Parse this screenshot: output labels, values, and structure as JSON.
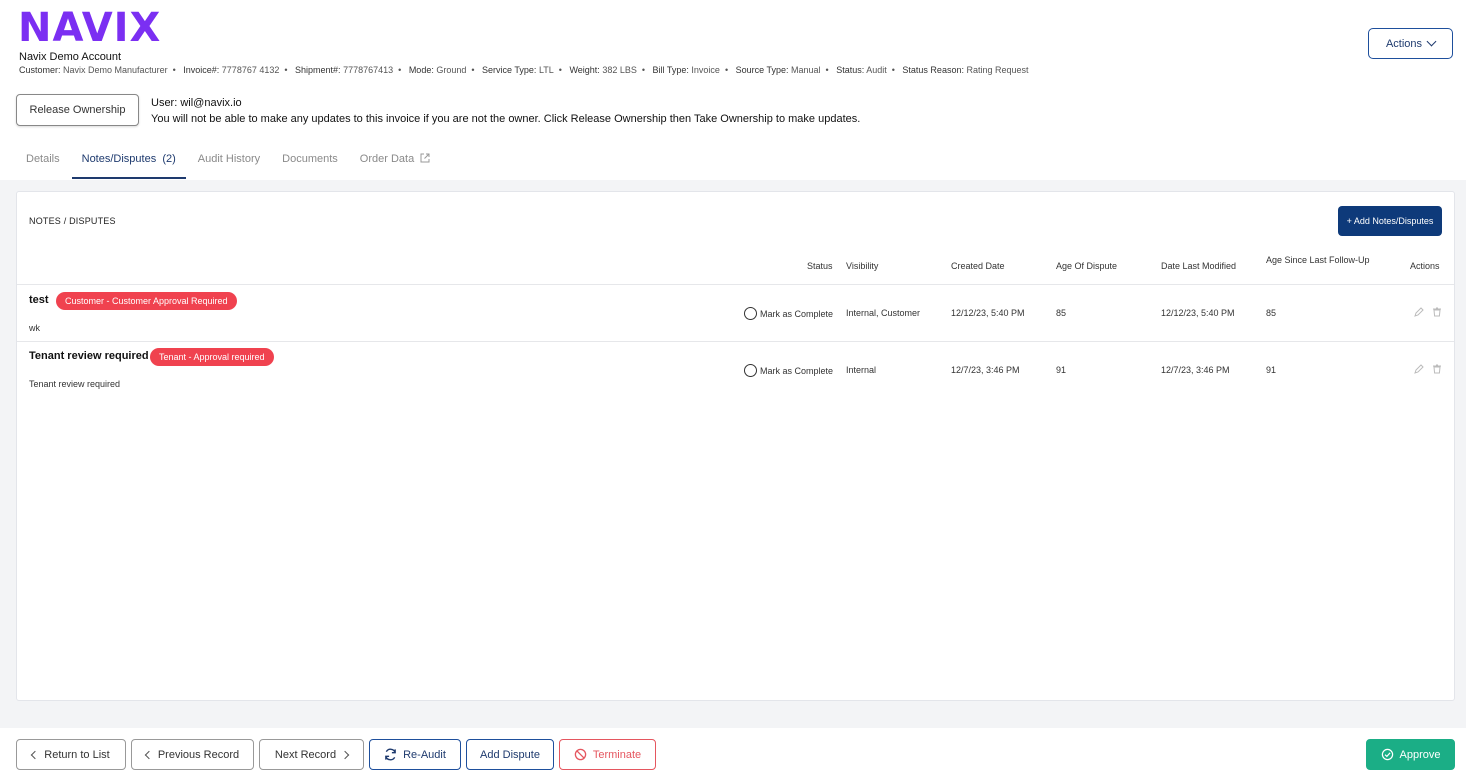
{
  "app": {
    "logo": "NAVIX",
    "account": "Navix Demo Account"
  },
  "meta": [
    {
      "key": "Customer:",
      "value": "Navix Demo Manufacturer"
    },
    {
      "key": "Invoice#:",
      "value": "7778767 4132"
    },
    {
      "key": "Shipment#:",
      "value": "7778767413"
    },
    {
      "key": "Mode:",
      "value": "Ground"
    },
    {
      "key": "Service Type:",
      "value": "LTL"
    },
    {
      "key": "Weight:",
      "value": "382 LBS"
    },
    {
      "key": "Bill Type:",
      "value": "Invoice"
    },
    {
      "key": "Source Type:",
      "value": "Manual"
    },
    {
      "key": "Status:",
      "value": "Audit"
    },
    {
      "key": "Status Reason:",
      "value": "Rating Request"
    }
  ],
  "header": {
    "actions_label": "Actions",
    "release_label": "Release Ownership",
    "user_line": "User: wil@navix.io",
    "warning": "You will not be able to make any updates to this invoice if you are not the owner. Click Release Ownership then Take Ownership to make updates."
  },
  "tabs": [
    {
      "label": "Details"
    },
    {
      "label": "Notes/Disputes  (2)"
    },
    {
      "label": "Audit History"
    },
    {
      "label": "Documents"
    },
    {
      "label": "Order Data"
    }
  ],
  "panel": {
    "title": "NOTES / DISPUTES",
    "add_label": "+ Add Notes/Disputes",
    "columns": {
      "status": "Status",
      "visibility": "Visibility",
      "created": "Created Date",
      "age": "Age Of Dispute",
      "modified": "Date Last Modified",
      "followup": "Age Since Last Follow-Up",
      "actions": "Actions"
    },
    "rows": [
      {
        "title": "test",
        "badge": "Customer - Customer Approval Required",
        "body": "wk",
        "status": "Mark as Complete",
        "visibility": "Internal, Customer",
        "created": "12/12/23, 5:40 PM",
        "age": "85",
        "modified": "12/12/23, 5:40 PM",
        "followup": "85"
      },
      {
        "title": "Tenant review required",
        "badge": "Tenant - Approval required",
        "body": "Tenant review required",
        "status": "Mark as Complete",
        "visibility": "Internal",
        "created": "12/7/23, 3:46 PM",
        "age": "91",
        "modified": "12/7/23, 3:46 PM",
        "followup": "91"
      }
    ]
  },
  "footer": {
    "return": "Return to List",
    "previous": "Previous Record",
    "next": "Next Record",
    "reaudit": "Re-Audit",
    "add_dispute": "Add Dispute",
    "terminate": "Terminate",
    "approve": "Approve"
  },
  "colors": {
    "brand": "#7b2ff2",
    "primary": "#0e3a7a",
    "danger": "#f0424f",
    "success": "#1bae86"
  }
}
